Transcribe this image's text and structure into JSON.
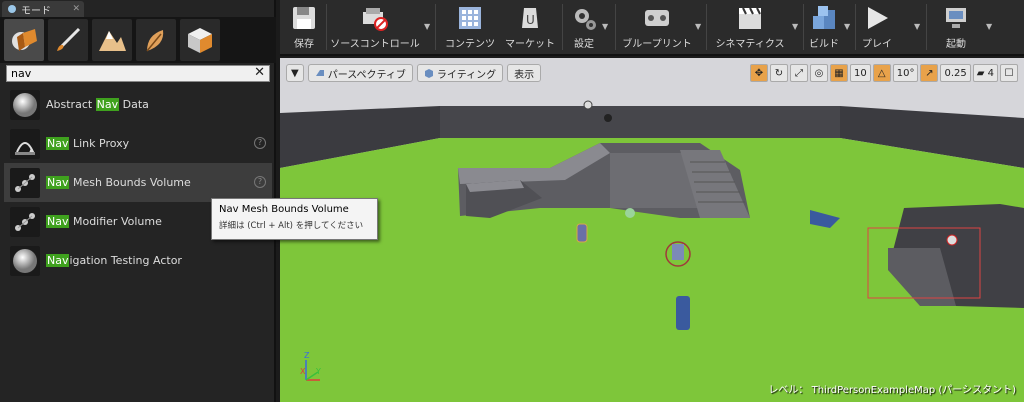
{
  "modes_panel": {
    "tab_title": "モード",
    "modes": [
      {
        "name": "place-mode",
        "icon": "place-cube-icon"
      },
      {
        "name": "paint-mode",
        "icon": "brush-icon"
      },
      {
        "name": "landscape-mode",
        "icon": "mountain-icon"
      },
      {
        "name": "foliage-mode",
        "icon": "leaf-icon"
      },
      {
        "name": "geometry-mode",
        "icon": "geometry-icon"
      }
    ],
    "search": {
      "value": "nav",
      "placeholder": ""
    },
    "results": [
      {
        "pre": "Abstract ",
        "match": "Nav",
        "post": " Data",
        "help": false
      },
      {
        "pre": "",
        "match": "Nav",
        "post": " Link Proxy",
        "help": true
      },
      {
        "pre": "",
        "match": "Nav",
        "post": " Mesh Bounds Volume",
        "help": true
      },
      {
        "pre": "",
        "match": "Nav",
        "post": " Modifier Volume",
        "help": true
      },
      {
        "pre": "",
        "match": "Nav",
        "post": "igation Testing Actor",
        "help": false
      }
    ]
  },
  "tooltip": {
    "title": "Nav Mesh Bounds Volume",
    "hint": "詳細は (Ctrl + Alt) を押してください"
  },
  "toolbar": {
    "save": "保存",
    "source_control": "ソースコントロール",
    "content": "コンテンツ",
    "marketplace": "マーケット",
    "settings": "設定",
    "blueprints": "ブループリント",
    "cinematics": "シネマティクス",
    "build": "ビルド",
    "play": "プレイ",
    "launch": "起動"
  },
  "viewport": {
    "perspective": "パースペクティブ",
    "lighting": "ライティング",
    "show": "表示",
    "grid_snap": "10",
    "rotation_snap": "10°",
    "scale_snap": "0.25",
    "camera_speed": "4",
    "level_label": "レベル：  ThirdPersonExampleMap (パーシスタント)"
  },
  "colors": {
    "highlight": "#3fa11e",
    "floor": "#7ec63a",
    "accent_orange": "#e8a24a"
  }
}
